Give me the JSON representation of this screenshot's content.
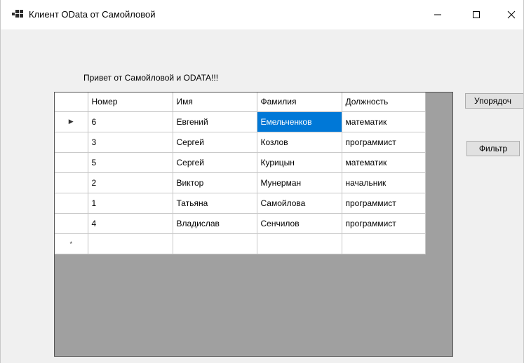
{
  "window": {
    "title": "Клиент OData  от Самойловой",
    "icon": "app-form-icon",
    "controls": [
      "minimize-icon",
      "maximize-icon",
      "close-icon"
    ]
  },
  "greeting": "Привет от Самойловой и ODATA!!!",
  "grid": {
    "columns": [
      "Номер",
      "Имя",
      "Фамилия",
      "Должность"
    ],
    "rows": [
      [
        "6",
        "Евгений",
        "Емельченков",
        "математик"
      ],
      [
        "3",
        "Сергей",
        "Козлов",
        "программист"
      ],
      [
        "5",
        "Сергей",
        "Курицын",
        "математик"
      ],
      [
        "2",
        "Виктор",
        "Мунерман",
        "начальник"
      ],
      [
        "1",
        "Татьяна",
        "Самойлова",
        "программист"
      ],
      [
        "4",
        "Владислав",
        "Сенчилов",
        "программист"
      ]
    ],
    "current_row_marker": "▶",
    "new_row_marker": "*",
    "selected_cell_color": "#0078d7"
  },
  "buttons": {
    "sort": "Упорядоч",
    "filter": "Фильтр"
  }
}
